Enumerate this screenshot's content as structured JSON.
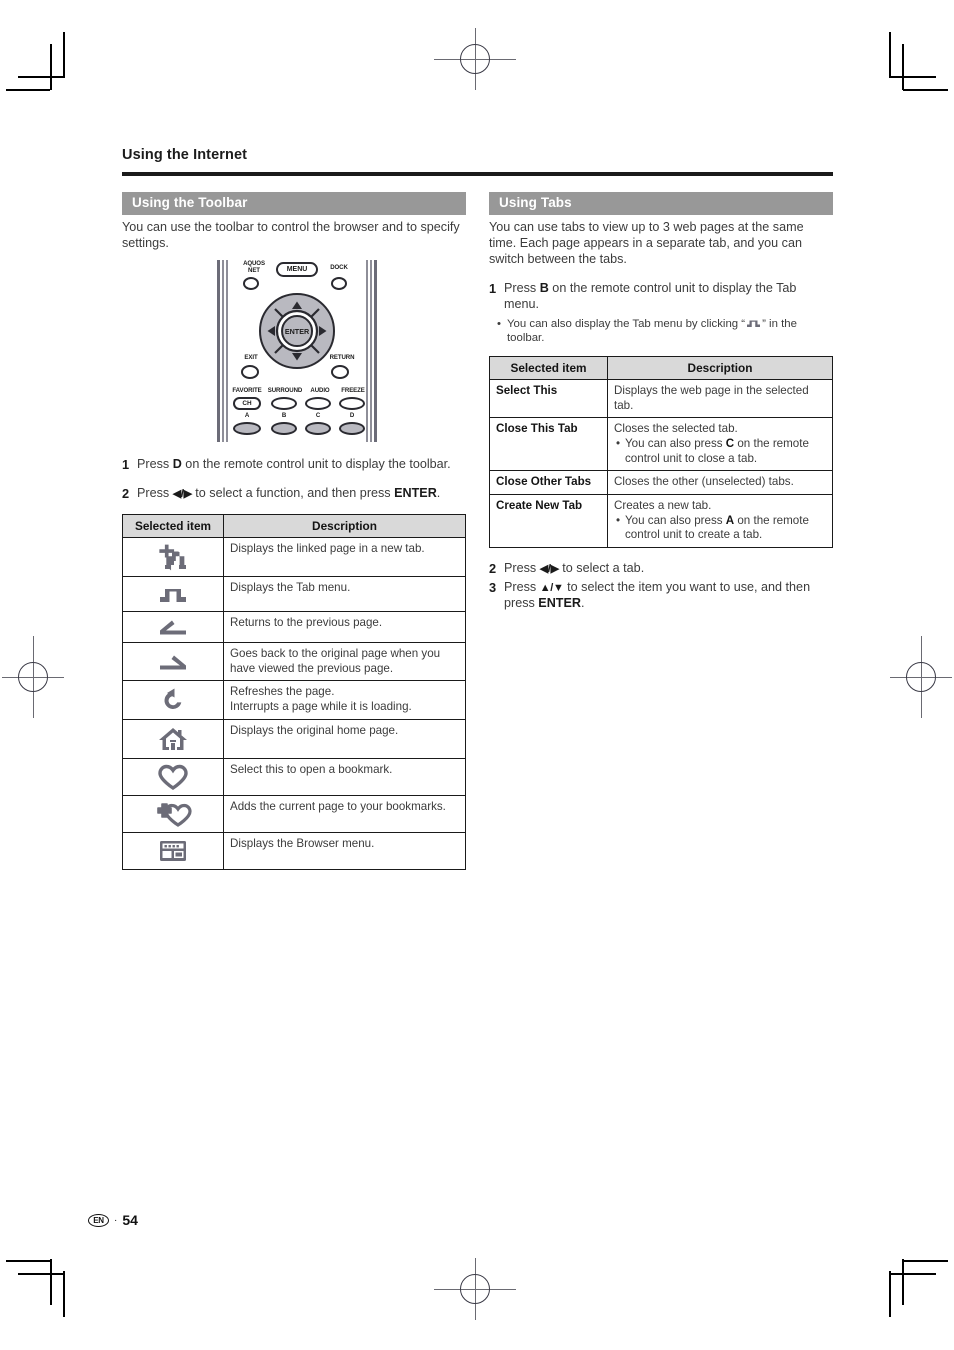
{
  "chapter": {
    "title": "Using the Internet"
  },
  "footer": {
    "lang_badge": "EN",
    "separator": "·",
    "page_number": "54"
  },
  "left": {
    "section_title": "Using the Toolbar",
    "intro": "You can use the toolbar to control the browser and to specify settings.",
    "remote": {
      "aquos_net_label": "AQUOS\nNET",
      "aquos_line1": "AQUOS",
      "aquos_line2": "NET",
      "menu_label": "MENU",
      "dock_label": "DOCK",
      "enter_label": "ENTER",
      "exit_label": "EXIT",
      "return_label": "RETURN",
      "favorite_label": "FAVORITE",
      "surround_label": "SURROUND",
      "audio_label": "AUDIO",
      "freeze_label": "FREEZE",
      "ch_label": "CH",
      "color_a": "A",
      "color_b": "B",
      "color_c": "C",
      "color_d": "D"
    },
    "steps": [
      {
        "num": "1",
        "text_before": "Press ",
        "key": "D",
        "text_after": " on the remote control unit to display the toolbar."
      },
      {
        "num": "2",
        "text_before": "Press ",
        "arrows": "◀/▶",
        "text_mid": " to select a function, and then press ",
        "key2": "ENTER",
        "text_after": "."
      }
    ],
    "table": {
      "headers": [
        "Selected item",
        "Description"
      ],
      "rows": [
        {
          "icon": "new-tab-icon",
          "description": "Displays the linked page in a new tab."
        },
        {
          "icon": "tab-menu-icon",
          "description": "Displays the Tab menu."
        },
        {
          "icon": "back-arrow-icon",
          "description": "Returns to the previous page."
        },
        {
          "icon": "forward-arrow-icon",
          "description": "Goes back to the original page when you have viewed the previous page."
        },
        {
          "icon": "refresh-icon",
          "description": "Refreshes the page.\nInterrupts a page while it is loading.",
          "line1": "Refreshes the page.",
          "line2": "Interrupts a page while it is loading."
        },
        {
          "icon": "home-icon",
          "description": "Displays the original home page."
        },
        {
          "icon": "bookmark-heart-icon",
          "description": "Select this to open a bookmark."
        },
        {
          "icon": "add-bookmark-icon",
          "description": "Adds the current page to your bookmarks."
        },
        {
          "icon": "browser-menu-icon",
          "description": "Displays the Browser menu."
        }
      ]
    }
  },
  "right": {
    "section_title": "Using Tabs",
    "intro": "You can use tabs to view up to 3 web pages at the same time. Each page appears in a separate tab, and you can switch between the tabs.",
    "step1": {
      "num": "1",
      "text_before": "Press ",
      "key": "B",
      "text_after": " on the remote control unit to display the Tab menu.",
      "bullet_before": "You can also display the Tab menu by clicking “",
      "bullet_after": "” in the toolbar."
    },
    "table": {
      "headers": [
        "Selected item",
        "Description"
      ],
      "rows": [
        {
          "item": "Select This",
          "desc": "Displays the web page in the selected tab.",
          "bullet": null
        },
        {
          "item": "Close This Tab",
          "desc": "Closes the selected tab.",
          "bullet_before": "You can also press ",
          "bullet_key": "C",
          "bullet_after": " on the remote control unit to close a tab."
        },
        {
          "item": "Close Other Tabs",
          "desc": "Closes the other (unselected) tabs.",
          "bullet": null
        },
        {
          "item": "Create New Tab",
          "desc": "Creates a new tab.",
          "bullet_before": "You can also press ",
          "bullet_key": "A",
          "bullet_after": " on the remote control unit to create a tab."
        }
      ]
    },
    "steps": [
      {
        "num": "2",
        "text_before": "Press ",
        "arrows": "◀/▶",
        "text_after": " to select a tab."
      },
      {
        "num": "3",
        "text_before": "Press ",
        "arrows": "▲/▼",
        "text_mid": " to select the item you want to use, and then press ",
        "key2": "ENTER",
        "text_after": "."
      }
    ]
  },
  "colors": {
    "section_header_bg": "#989898",
    "table_header_bg": "#d9d9d9",
    "icon_grey": "#6c6c78",
    "rule_black": "#1a1a1a"
  }
}
